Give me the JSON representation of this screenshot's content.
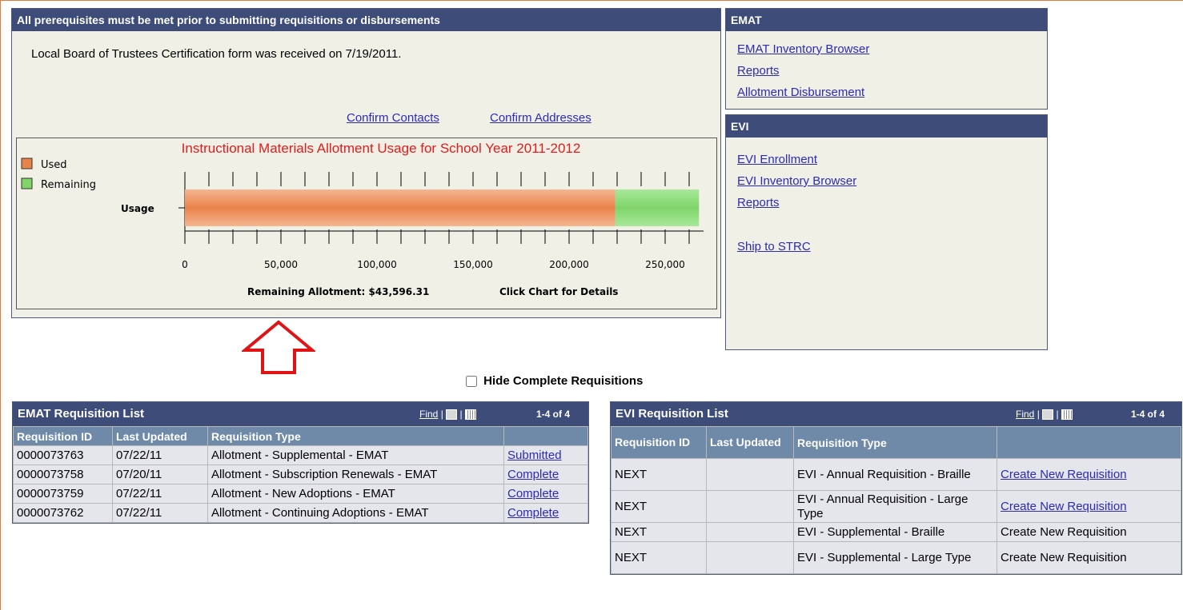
{
  "prereq": {
    "header": "All prerequisites must be met prior to submitting requisitions or disbursements",
    "message": "Local Board of Trustees Certification form was received on 7/19/2011.",
    "confirm_contacts": "Confirm Contacts",
    "confirm_addresses": "Confirm Addresses"
  },
  "chart_data": {
    "type": "bar",
    "orientation": "horizontal",
    "stacked": true,
    "title": "Instructional Materials Allotment Usage for School Year 2011-2012",
    "categories": [
      "Usage"
    ],
    "series": [
      {
        "name": "Used",
        "values": [
          224000
        ],
        "color": "#e8834a"
      },
      {
        "name": "Remaining",
        "values": [
          43596.31
        ],
        "color": "#7fd46a"
      }
    ],
    "xlim": [
      0,
      270000
    ],
    "x_ticks": [
      "0",
      "50,000",
      "100,000",
      "150,000",
      "200,000",
      "250,000"
    ],
    "x_tick_values": [
      0,
      50000,
      100000,
      150000,
      200000,
      250000
    ],
    "legend_position": "top-left",
    "footer_left": "Remaining Allotment: $43,596.31",
    "footer_right": "Click Chart for Details"
  },
  "emat_panel": {
    "header": "EMAT",
    "links": [
      "EMAT Inventory Browser",
      "Reports",
      "Allotment Disbursement"
    ]
  },
  "evi_panel": {
    "header": "EVI",
    "links": [
      "EVI Enrollment",
      "EVI Inventory Browser",
      "Reports",
      "Ship to STRC"
    ]
  },
  "hide_complete": {
    "label": "Hide Complete Requisitions",
    "checked": false
  },
  "emat_list": {
    "title": "EMAT Requisition List",
    "find": "Find",
    "range": "1-4 of 4",
    "columns": [
      "Requisition ID",
      "Last Updated",
      "Requisition Type",
      ""
    ],
    "rows": [
      {
        "id": "0000073763",
        "updated": "07/22/11",
        "type": "Allotment - Supplemental - EMAT",
        "status": "Submitted"
      },
      {
        "id": "0000073758",
        "updated": "07/20/11",
        "type": "Allotment - Subscription Renewals - EMAT",
        "status": "Complete"
      },
      {
        "id": "0000073759",
        "updated": "07/22/11",
        "type": "Allotment - New Adoptions - EMAT",
        "status": "Complete"
      },
      {
        "id": "0000073762",
        "updated": "07/22/11",
        "type": "Allotment - Continuing Adoptions - EMAT",
        "status": "Complete"
      }
    ]
  },
  "evi_list": {
    "title": "EVI Requisition List",
    "find": "Find",
    "range": "1-4 of 4",
    "columns": [
      "Requisition ID",
      "Last Updated",
      "Requisition Type",
      ""
    ],
    "rows": [
      {
        "id": "NEXT",
        "updated": "",
        "type": "EVI - Annual Requisition - Braille",
        "action": "Create New Requisition"
      },
      {
        "id": "NEXT",
        "updated": "",
        "type": "EVI - Annual Requisition - Large Type",
        "action": "Create New Requisition"
      },
      {
        "id": "NEXT",
        "updated": "",
        "type": "EVI - Supplemental - Braille",
        "action": "Create New Requisition"
      },
      {
        "id": "NEXT",
        "updated": "",
        "type": "EVI - Supplemental - Large Type",
        "action": "Create New Requisition"
      }
    ]
  },
  "annotation": {
    "icon": "up-arrow-icon",
    "color": "#e01414"
  }
}
